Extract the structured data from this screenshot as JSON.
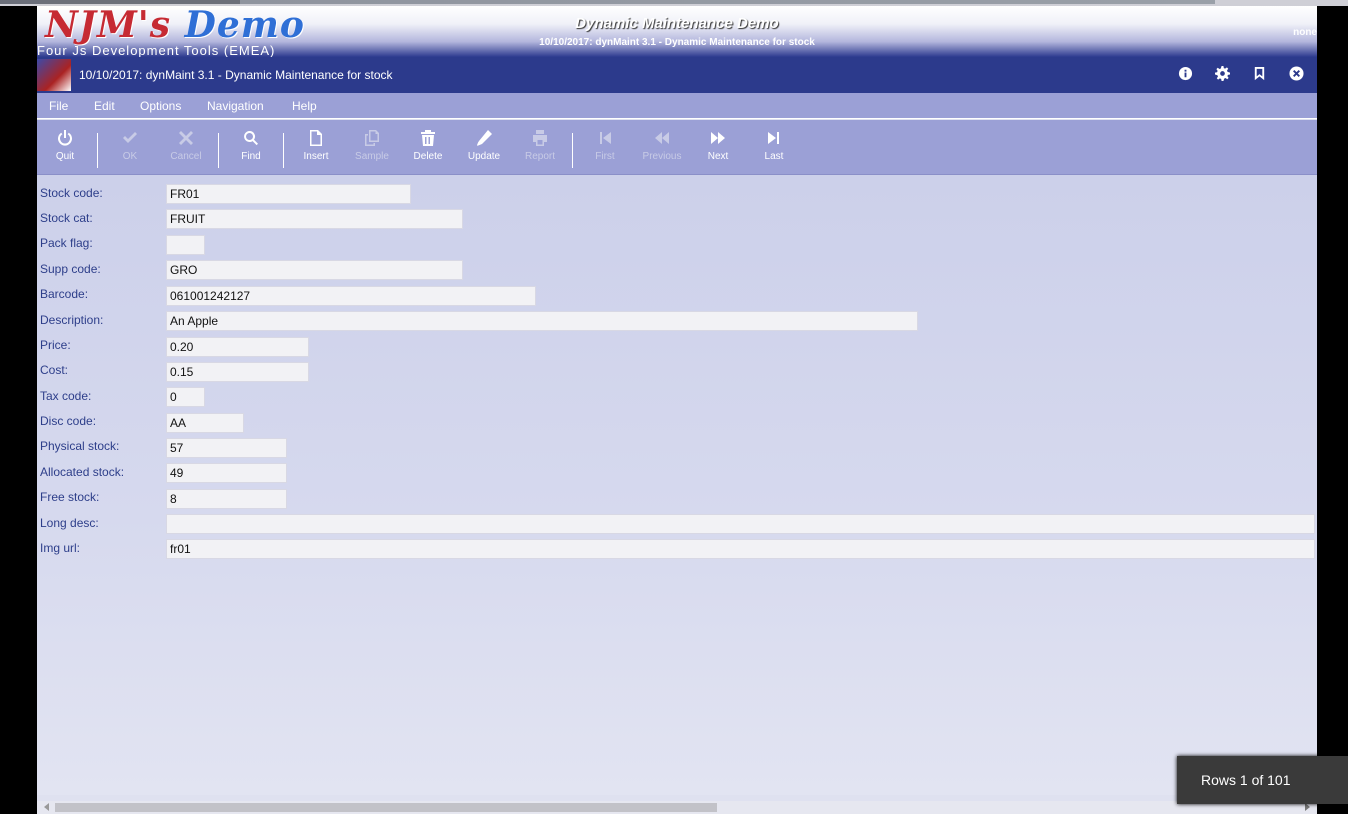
{
  "banner": {
    "logo_part1": "NJM's ",
    "logo_part2": "Demo",
    "logo_subtitle": "Four Js Development Tools (EMEA)",
    "title": "Dynamic Maintenance Demo",
    "subtitle": "10/10/2017: dynMaint 3.1 - Dynamic Maintenance for stock",
    "user": "none"
  },
  "titlebar": {
    "title": "10/10/2017: dynMaint 3.1 - Dynamic Maintenance for stock",
    "icons": [
      "info-icon",
      "gear-icon",
      "bookmark-icon",
      "close-icon"
    ]
  },
  "menu": {
    "items": [
      "File",
      "Edit",
      "Options",
      "Navigation",
      "Help"
    ]
  },
  "toolbar": {
    "buttons": [
      {
        "label": "Quit",
        "icon": "power-icon",
        "enabled": true
      },
      {
        "label": "OK",
        "icon": "check-icon",
        "enabled": false
      },
      {
        "label": "Cancel",
        "icon": "x-icon",
        "enabled": false
      },
      {
        "label": "Find",
        "icon": "search-icon",
        "enabled": true
      },
      {
        "label": "Insert",
        "icon": "file-icon",
        "enabled": true
      },
      {
        "label": "Sample",
        "icon": "copy-icon",
        "enabled": false
      },
      {
        "label": "Delete",
        "icon": "trash-icon",
        "enabled": true
      },
      {
        "label": "Update",
        "icon": "pencil-icon",
        "enabled": true
      },
      {
        "label": "Report",
        "icon": "print-icon",
        "enabled": false
      },
      {
        "label": "First",
        "icon": "first-icon",
        "enabled": false
      },
      {
        "label": "Previous",
        "icon": "rewind-icon",
        "enabled": false
      },
      {
        "label": "Next",
        "icon": "forward-icon",
        "enabled": true
      },
      {
        "label": "Last",
        "icon": "last-icon",
        "enabled": true
      }
    ]
  },
  "form": {
    "fields": [
      {
        "label": "Stock code:",
        "value": "FR01"
      },
      {
        "label": "Stock cat:",
        "value": "FRUIT"
      },
      {
        "label": "Pack flag:",
        "value": ""
      },
      {
        "label": "Supp code:",
        "value": "GRO"
      },
      {
        "label": "Barcode:",
        "value": "061001242127"
      },
      {
        "label": "Description:",
        "value": "An Apple"
      },
      {
        "label": "Price:",
        "value": "0.20"
      },
      {
        "label": "Cost:",
        "value": "0.15"
      },
      {
        "label": "Tax code:",
        "value": "0"
      },
      {
        "label": "Disc code:",
        "value": "AA"
      },
      {
        "label": "Physical stock:",
        "value": "57"
      },
      {
        "label": "Allocated stock:",
        "value": "49"
      },
      {
        "label": "Free stock:",
        "value": "8"
      },
      {
        "label": "Long desc:",
        "value": ""
      },
      {
        "label": "Img url:",
        "value": "fr01"
      }
    ]
  },
  "status": {
    "rows": "Rows 1 of 101"
  },
  "colors": {
    "titlebar": "#2c3a8c",
    "toolbar": "#9ba0d6",
    "label_text": "#2d3e8a"
  }
}
